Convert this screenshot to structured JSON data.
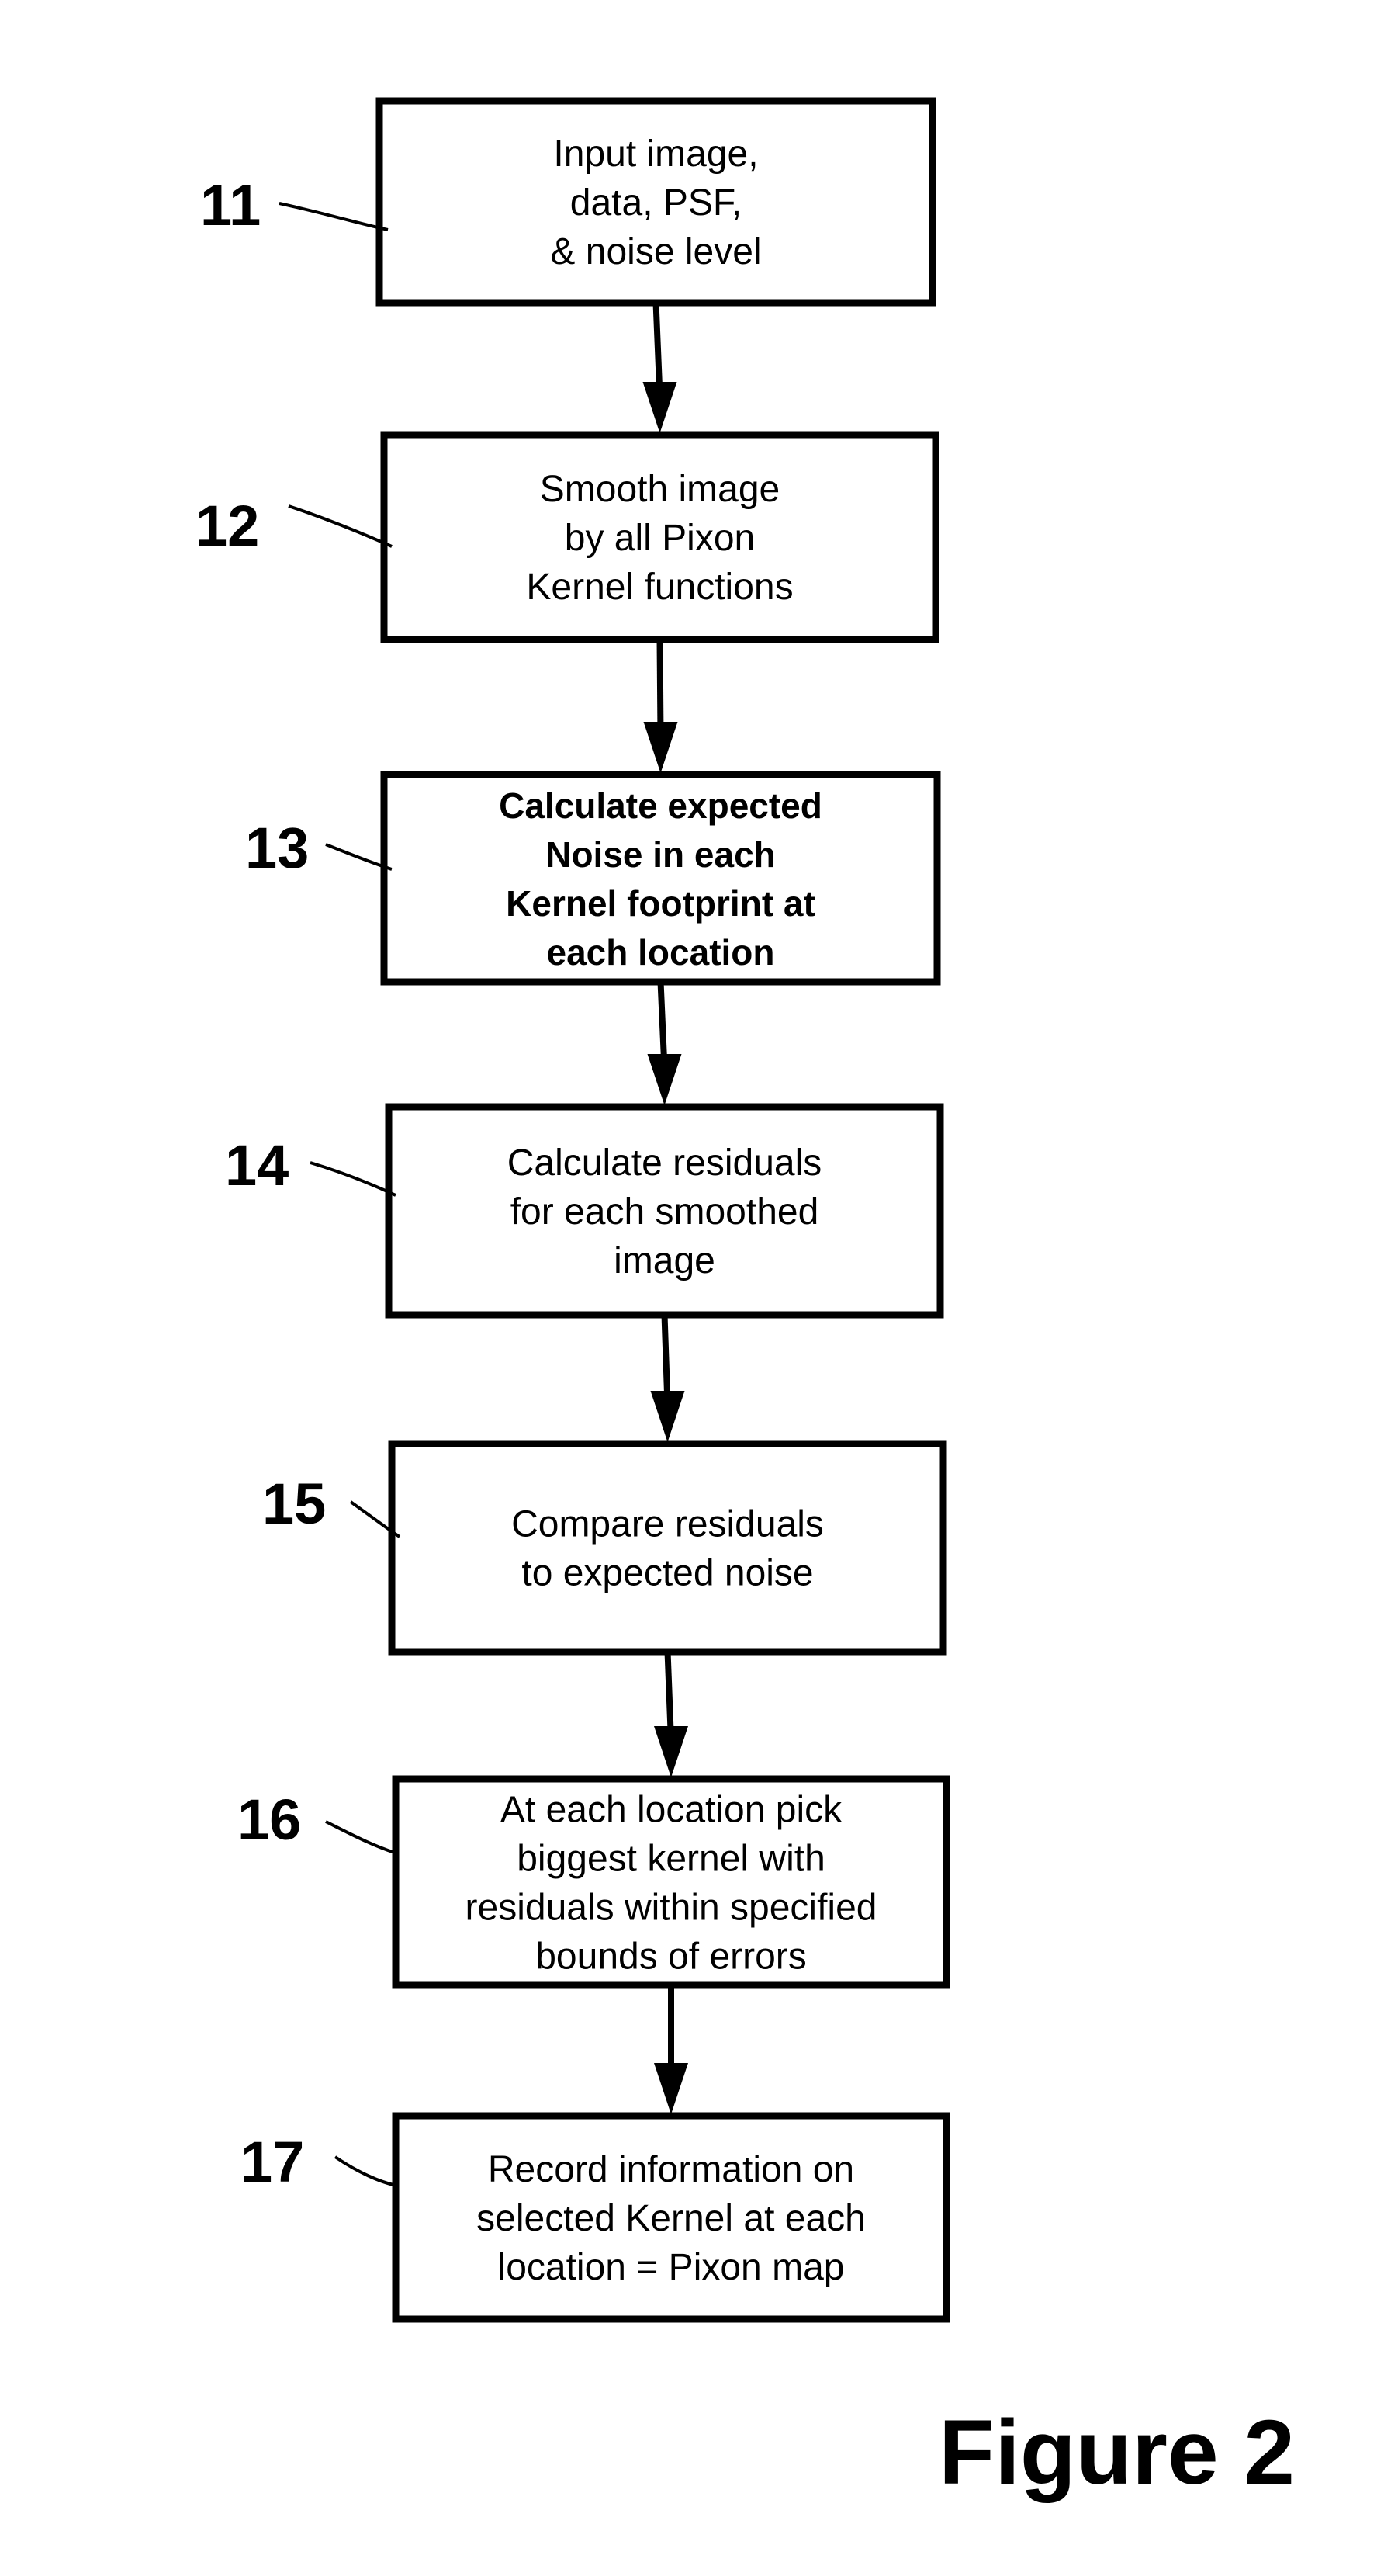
{
  "figure_label": "Figure 2",
  "steps": [
    {
      "ref": "11",
      "lines": [
        "Input image,",
        "data, PSF,",
        "& noise level"
      ],
      "bold": false
    },
    {
      "ref": "12",
      "lines": [
        "Smooth image",
        "by all Pixon",
        "Kernel functions"
      ],
      "bold": false
    },
    {
      "ref": "13",
      "lines": [
        "Calculate expected",
        "Noise in each",
        "Kernel footprint at",
        "each location"
      ],
      "bold": true
    },
    {
      "ref": "14",
      "lines": [
        "Calculate residuals",
        "for each smoothed",
        "image"
      ],
      "bold": false
    },
    {
      "ref": "15",
      "lines": [
        "Compare residuals",
        "to expected noise"
      ],
      "bold": false
    },
    {
      "ref": "16",
      "lines": [
        "At each location pick",
        "biggest kernel with",
        "residuals within specified",
        "bounds of errors"
      ],
      "bold": false
    },
    {
      "ref": "17",
      "lines": [
        "Record information on",
        "selected Kernel at each",
        "location = Pixon map"
      ],
      "bold": false
    }
  ],
  "connections": [
    {
      "from": "11",
      "to": "12"
    },
    {
      "from": "12",
      "to": "13"
    },
    {
      "from": "13",
      "to": "14"
    },
    {
      "from": "14",
      "to": "15"
    },
    {
      "from": "15",
      "to": "16"
    },
    {
      "from": "16",
      "to": "17"
    }
  ]
}
